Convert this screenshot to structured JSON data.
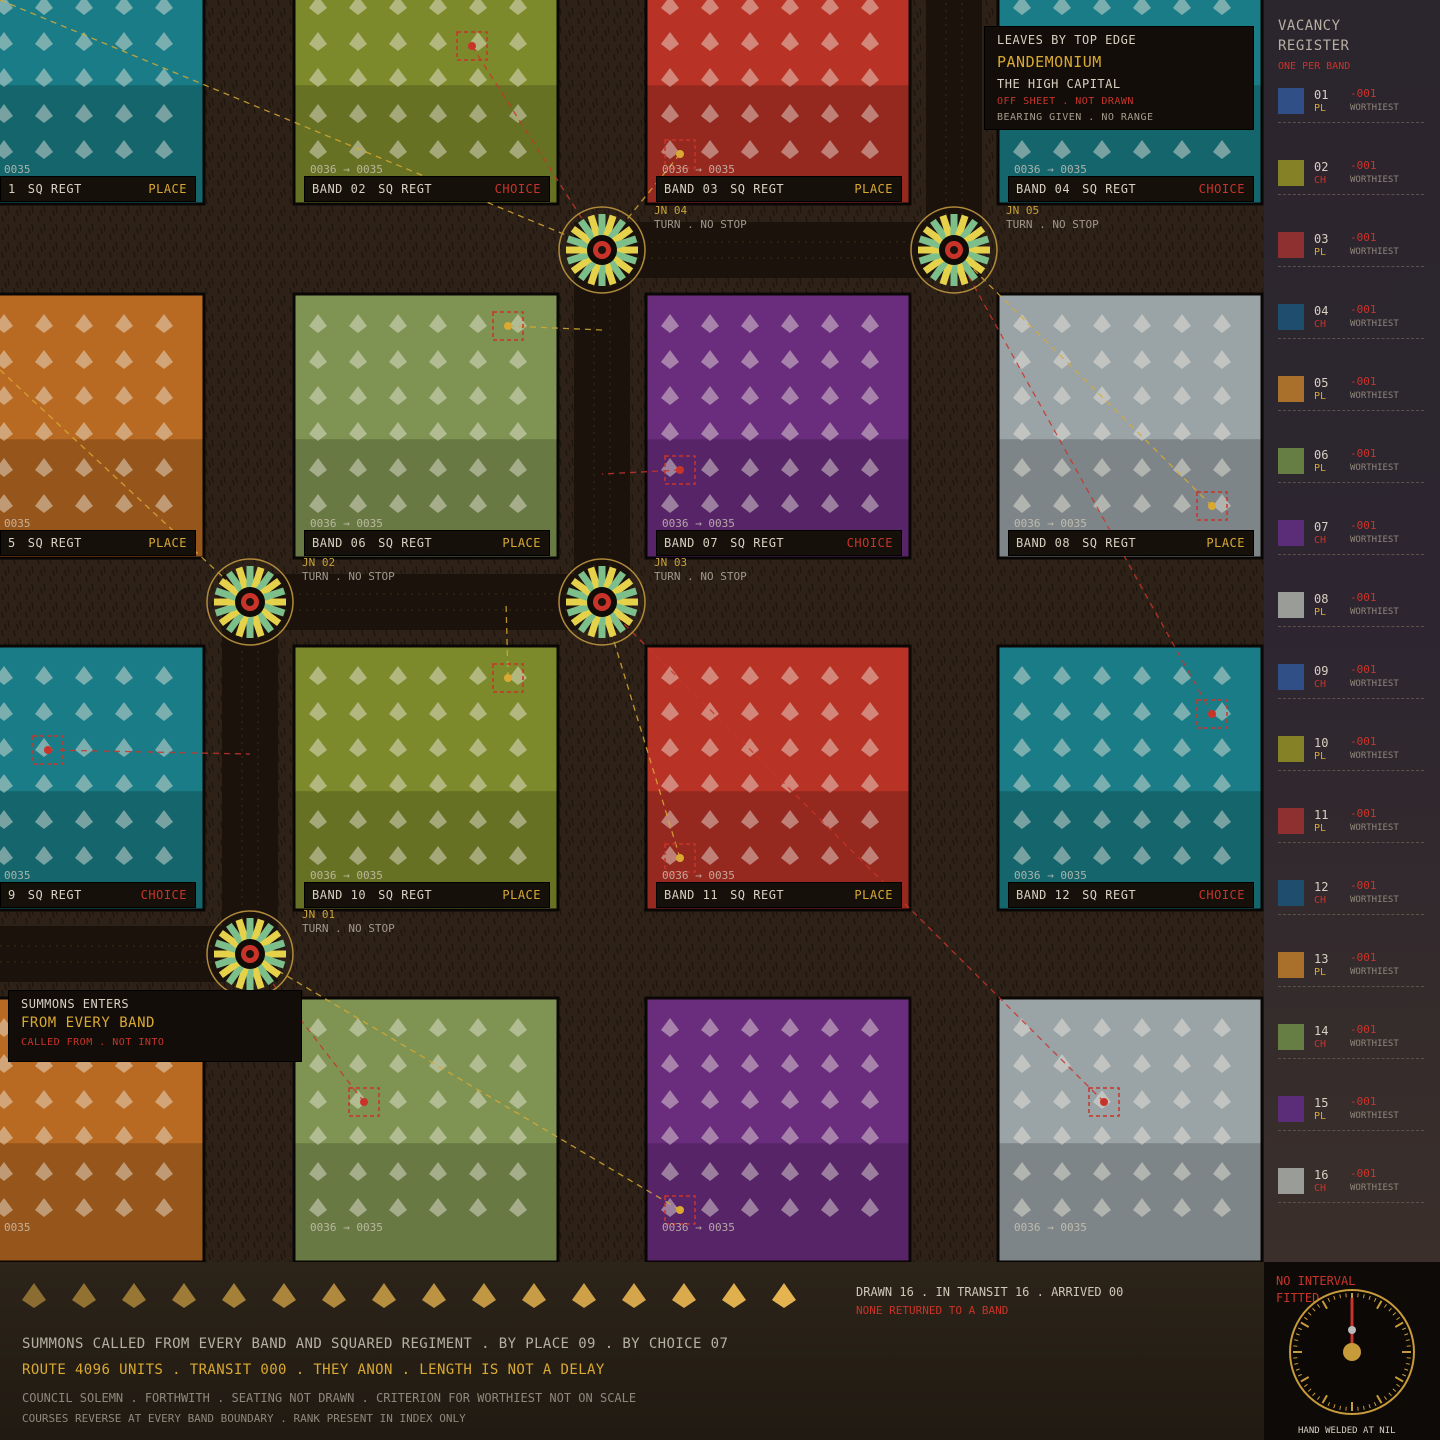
{
  "palette": {
    "teal": "#1a7c86",
    "olive": "#7d8a2c",
    "red": "#b83326",
    "purple": "#6a2d7e",
    "orange": "#b86a22",
    "sage": "#7f9452",
    "silver": "#9aa3a6",
    "gold": "#d9a932",
    "accent_red": "#c8342a",
    "route_green": "#9cc36a",
    "route_yellow": "#e8c547"
  },
  "bands": [
    {
      "num": "01",
      "kind": "PLACE",
      "colour": "teal",
      "band_label": "1",
      "range": "0035"
    },
    {
      "num": "02",
      "kind": "CHOICE",
      "colour": "olive",
      "band_label": "BAND 02",
      "range": "0036 → 0035"
    },
    {
      "num": "03",
      "kind": "PLACE",
      "colour": "red",
      "band_label": "BAND 03",
      "range": "0036 → 0035"
    },
    {
      "num": "04",
      "kind": "CHOICE",
      "colour": "teal",
      "band_label": "BAND 04",
      "range": "0036 → 0035"
    },
    {
      "num": "05",
      "kind": "PLACE",
      "colour": "orange",
      "band_label": "5",
      "range": "0035"
    },
    {
      "num": "06",
      "kind": "PLACE",
      "colour": "sage",
      "band_label": "BAND 06",
      "range": "0036 → 0035"
    },
    {
      "num": "07",
      "kind": "CHOICE",
      "colour": "purple",
      "band_label": "BAND 07",
      "range": "0036 → 0035"
    },
    {
      "num": "08",
      "kind": "PLACE",
      "colour": "silver",
      "band_label": "BAND 08",
      "range": "0036 → 0035"
    },
    {
      "num": "09",
      "kind": "CHOICE",
      "colour": "teal",
      "band_label": "9",
      "range": "0035"
    },
    {
      "num": "10",
      "kind": "PLACE",
      "colour": "olive",
      "band_label": "BAND 10",
      "range": "0036 → 0035"
    },
    {
      "num": "11",
      "kind": "PLACE",
      "colour": "red",
      "band_label": "BAND 11",
      "range": "0036 → 0035"
    },
    {
      "num": "12",
      "kind": "CHOICE",
      "colour": "teal",
      "band_label": "BAND 12",
      "range": "0036 → 0035"
    },
    {
      "num": "13",
      "kind": "",
      "colour": "orange",
      "band_label": "",
      "range": "0035"
    },
    {
      "num": "14",
      "kind": "",
      "colour": "sage",
      "band_label": "",
      "range": "0036 → 0035"
    },
    {
      "num": "15",
      "kind": "",
      "colour": "purple",
      "band_label": "",
      "range": "0036 → 0035"
    },
    {
      "num": "16",
      "kind": "",
      "colour": "silver",
      "band_label": "",
      "range": "0036 → 0035"
    }
  ],
  "tile_suffix": "SQ REGT",
  "junctions": [
    {
      "id": "JN 01",
      "note": "TURN . NO STOP"
    },
    {
      "id": "JN 02",
      "note": "TURN . NO STOP"
    },
    {
      "id": "JN 03",
      "note": "TURN . NO STOP"
    },
    {
      "id": "JN 04",
      "note": "TURN . NO STOP"
    },
    {
      "id": "JN 05",
      "note": "TURN . NO STOP"
    }
  ],
  "exit_panel": {
    "line1": "LEAVES BY TOP EDGE",
    "title": "PANDEMONIUM",
    "subtitle": "THE HIGH CAPITAL",
    "warning": "OFF SHEET . NOT DRAWN",
    "note": "BEARING GIVEN . NO RANGE"
  },
  "entry_panel": {
    "line1": "SUMMONS ENTERS",
    "title": "FROM EVERY BAND",
    "note": "CALLED FROM . NOT INTO"
  },
  "register": {
    "title_1": "VACANCY",
    "title_2": "REGISTER",
    "subtitle": "ONE PER BAND",
    "rows": [
      {
        "num": "01",
        "code": "PL",
        "value": "-001",
        "label": "WORTHIEST",
        "colour": "#2f4f86"
      },
      {
        "num": "02",
        "code": "CH",
        "value": "-001",
        "label": "WORTHIEST",
        "colour": "#858126"
      },
      {
        "num": "03",
        "code": "PL",
        "value": "-001",
        "label": "WORTHIEST",
        "colour": "#8e3030"
      },
      {
        "num": "04",
        "code": "CH",
        "value": "-001",
        "label": "WORTHIEST",
        "colour": "#1f4d6e"
      },
      {
        "num": "05",
        "code": "PL",
        "value": "-001",
        "label": "WORTHIEST",
        "colour": "#a8702a"
      },
      {
        "num": "06",
        "code": "PL",
        "value": "-001",
        "label": "WORTHIEST",
        "colour": "#667d44"
      },
      {
        "num": "07",
        "code": "CH",
        "value": "-001",
        "label": "WORTHIEST",
        "colour": "#5b2c77"
      },
      {
        "num": "08",
        "code": "PL",
        "value": "-001",
        "label": "WORTHIEST",
        "colour": "#9a9c98"
      },
      {
        "num": "09",
        "code": "CH",
        "value": "-001",
        "label": "WORTHIEST",
        "colour": "#2f4f86"
      },
      {
        "num": "10",
        "code": "PL",
        "value": "-001",
        "label": "WORTHIEST",
        "colour": "#858126"
      },
      {
        "num": "11",
        "code": "PL",
        "value": "-001",
        "label": "WORTHIEST",
        "colour": "#8e3030"
      },
      {
        "num": "12",
        "code": "CH",
        "value": "-001",
        "label": "WORTHIEST",
        "colour": "#1f4d6e"
      },
      {
        "num": "13",
        "code": "PL",
        "value": "-001",
        "label": "WORTHIEST",
        "colour": "#a8702a"
      },
      {
        "num": "14",
        "code": "CH",
        "value": "-001",
        "label": "WORTHIEST",
        "colour": "#667d44"
      },
      {
        "num": "15",
        "code": "PL",
        "value": "-001",
        "label": "WORTHIEST",
        "colour": "#5b2c77"
      },
      {
        "num": "16",
        "code": "CH",
        "value": "-001",
        "label": "WORTHIEST",
        "colour": "#9a9c98"
      }
    ]
  },
  "footer": {
    "counts": "DRAWN 16 . IN TRANSIT 16 . ARRIVED 00",
    "counts_note": "NONE RETURNED TO A BAND",
    "line1": "SUMMONS CALLED FROM EVERY BAND AND SQUARED REGIMENT . BY PLACE 09 . BY CHOICE 07",
    "line2": "ROUTE 4096 UNITS . TRANSIT 000 . THEY ANON . LENGTH IS NOT A DELAY",
    "line3": "COUNCIL SOLEMN . FORTHWITH . SEATING NOT DRAWN . CRITERION FOR WORTHIEST NOT ON SCALE",
    "line4": "COURSES REVERSE AT EVERY BAND BOUNDARY . RANK PRESENT IN INDEX ONLY",
    "leaf_icon": "leaf-icon",
    "leaf_count": 16
  },
  "clock": {
    "label_1": "NO INTERVAL",
    "label_2": "FITTED",
    "caption": "HAND WELDED AT NIL",
    "hand_value": 0
  }
}
